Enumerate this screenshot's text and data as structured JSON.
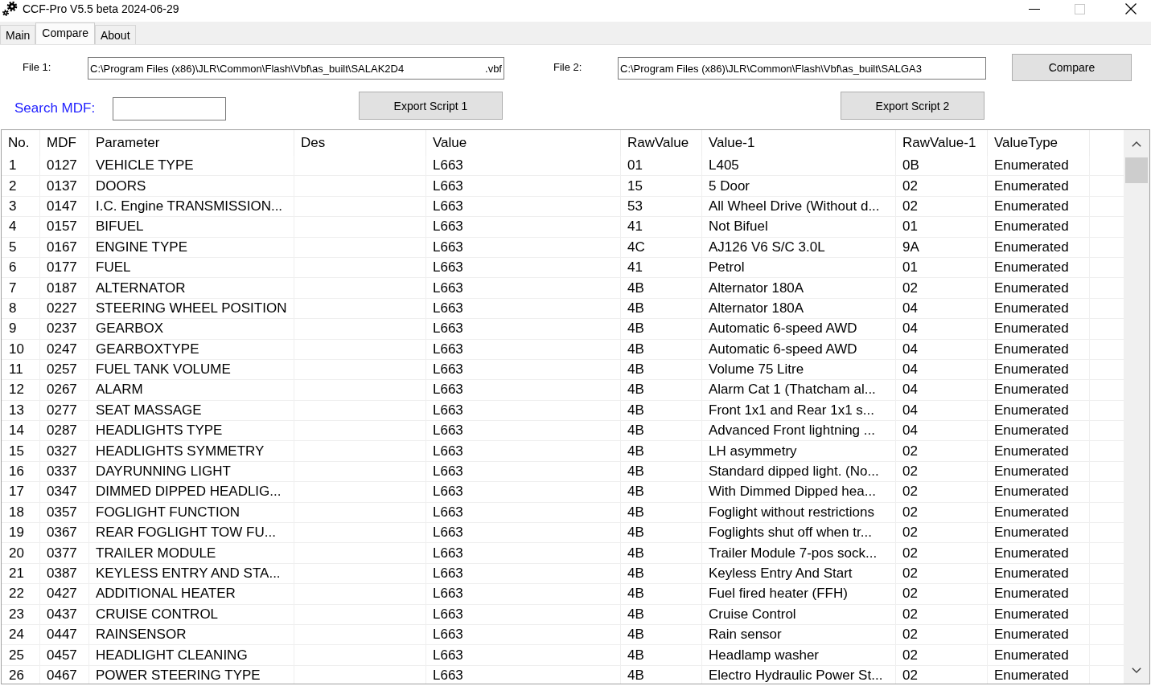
{
  "window": {
    "title": "CCF-Pro V5.5 beta 2024-06-29",
    "maximize_disabled": true
  },
  "tabs": [
    {
      "label": "Main",
      "selected": false
    },
    {
      "label": "Compare",
      "selected": true
    },
    {
      "label": "About",
      "selected": false
    }
  ],
  "file_1": {
    "label": "File 1:",
    "value": "C:\\Program Files (x86)\\JLR\\Common\\Flash\\Vbf\\as_built\\SALAK2D4",
    "value_end": ".vbf"
  },
  "file_2": {
    "label": "File 2:",
    "value": "C:\\Program Files (x86)\\JLR\\Common\\Flash\\Vbf\\as_built\\SALGA3"
  },
  "compare_button": "Compare",
  "search": {
    "label": "Search MDF:"
  },
  "export_buttons": [
    "Export Script 1",
    "Export Script 2"
  ],
  "table": {
    "columns": [
      "No.",
      "MDF",
      "Parameter",
      "Des",
      "Value",
      "RawValue",
      "Value-1",
      "RawValue-1",
      "ValueType"
    ],
    "rows": [
      {
        "no": "1",
        "mdf": "0127",
        "parameter": "VEHICLE TYPE",
        "value": "L663",
        "raw_value": "01",
        "value_1": "L405",
        "raw_value_1": "0B",
        "value_type": "Enumerated"
      },
      {
        "no": "2",
        "mdf": "0137",
        "parameter": "DOORS",
        "value": "L663",
        "raw_value": "15",
        "value_1": "5 Door",
        "raw_value_1": "02",
        "value_type": "Enumerated"
      },
      {
        "no": "3",
        "mdf": "0147",
        "parameter": "I.C. Engine TRANSMISSION...",
        "value": "L663",
        "raw_value": "53",
        "value_1": "All Wheel Drive (Without d...",
        "raw_value_1": "02",
        "value_type": "Enumerated"
      },
      {
        "no": "4",
        "mdf": "0157",
        "parameter": "BIFUEL",
        "value": "L663",
        "raw_value": "41",
        "value_1": "Not Bifuel",
        "raw_value_1": "01",
        "value_type": "Enumerated"
      },
      {
        "no": "5",
        "mdf": "0167",
        "parameter": "ENGINE TYPE",
        "value": "L663",
        "raw_value": "4C",
        "value_1": "AJ126 V6 S/C 3.0L",
        "raw_value_1": "9A",
        "value_type": "Enumerated"
      },
      {
        "no": "6",
        "mdf": "0177",
        "parameter": "FUEL",
        "value": "L663",
        "raw_value": "41",
        "value_1": "Petrol",
        "raw_value_1": "01",
        "value_type": "Enumerated"
      },
      {
        "no": "7",
        "mdf": "0187",
        "parameter": "ALTERNATOR",
        "value": "L663",
        "raw_value": "4B",
        "value_1": "Alternator 180A",
        "raw_value_1": "02",
        "value_type": "Enumerated"
      },
      {
        "no": "8",
        "mdf": "0227",
        "parameter": "STEERING WHEEL POSITION",
        "value": "L663",
        "raw_value": "4B",
        "value_1": "Alternator 180A",
        "raw_value_1": "04",
        "value_type": "Enumerated"
      },
      {
        "no": "9",
        "mdf": "0237",
        "parameter": "GEARBOX",
        "value": "L663",
        "raw_value": "4B",
        "value_1": "Automatic 6-speed AWD",
        "raw_value_1": "04",
        "value_type": "Enumerated"
      },
      {
        "no": "10",
        "mdf": "0247",
        "parameter": "GEARBOXTYPE",
        "value": "L663",
        "raw_value": "4B",
        "value_1": "Automatic 6-speed AWD",
        "raw_value_1": "04",
        "value_type": "Enumerated"
      },
      {
        "no": "11",
        "mdf": "0257",
        "parameter": "FUEL TANK VOLUME",
        "value": "L663",
        "raw_value": "4B",
        "value_1": "Volume 75 Litre",
        "raw_value_1": "04",
        "value_type": "Enumerated"
      },
      {
        "no": "12",
        "mdf": "0267",
        "parameter": "ALARM",
        "value": "L663",
        "raw_value": "4B",
        "value_1": "Alarm Cat 1 (Thatcham al...",
        "raw_value_1": "04",
        "value_type": "Enumerated"
      },
      {
        "no": "13",
        "mdf": "0277",
        "parameter": "SEAT MASSAGE",
        "value": "L663",
        "raw_value": "4B",
        "value_1": "Front 1x1 and Rear 1x1 s...",
        "raw_value_1": "04",
        "value_type": "Enumerated"
      },
      {
        "no": "14",
        "mdf": "0287",
        "parameter": "HEADLIGHTS TYPE",
        "value": "L663",
        "raw_value": "4B",
        "value_1": "Advanced Front lightning ...",
        "raw_value_1": "04",
        "value_type": "Enumerated"
      },
      {
        "no": "15",
        "mdf": "0327",
        "parameter": "HEADLIGHTS SYMMETRY",
        "value": "L663",
        "raw_value": "4B",
        "value_1": "LH asymmetry",
        "raw_value_1": "02",
        "value_type": "Enumerated"
      },
      {
        "no": "16",
        "mdf": "0337",
        "parameter": "DAYRUNNING LIGHT",
        "value": "L663",
        "raw_value": "4B",
        "value_1": "Standard dipped light. (No...",
        "raw_value_1": "02",
        "value_type": "Enumerated"
      },
      {
        "no": "17",
        "mdf": "0347",
        "parameter": "DIMMED DIPPED HEADLIG...",
        "value": "L663",
        "raw_value": "4B",
        "value_1": "With Dimmed Dipped hea...",
        "raw_value_1": "02",
        "value_type": "Enumerated"
      },
      {
        "no": "18",
        "mdf": "0357",
        "parameter": "FOGLIGHT FUNCTION",
        "value": "L663",
        "raw_value": "4B",
        "value_1": "Foglight without restrictions",
        "raw_value_1": "02",
        "value_type": "Enumerated"
      },
      {
        "no": "19",
        "mdf": "0367",
        "parameter": "REAR FOGLIGHT TOW FU...",
        "value": "L663",
        "raw_value": "4B",
        "value_1": "Foglights shut off when tr...",
        "raw_value_1": "02",
        "value_type": "Enumerated"
      },
      {
        "no": "20",
        "mdf": "0377",
        "parameter": "TRAILER MODULE",
        "value": "L663",
        "raw_value": "4B",
        "value_1": "Trailer Module 7-pos sock...",
        "raw_value_1": "02",
        "value_type": "Enumerated"
      },
      {
        "no": "21",
        "mdf": "0387",
        "parameter": "KEYLESS ENTRY AND STA...",
        "value": "L663",
        "raw_value": "4B",
        "value_1": "Keyless Entry And Start",
        "raw_value_1": "02",
        "value_type": "Enumerated"
      },
      {
        "no": "22",
        "mdf": "0427",
        "parameter": "ADDITIONAL HEATER",
        "value": "L663",
        "raw_value": "4B",
        "value_1": "Fuel fired heater (FFH)",
        "raw_value_1": "02",
        "value_type": "Enumerated"
      },
      {
        "no": "23",
        "mdf": "0437",
        "parameter": "CRUISE CONTROL",
        "value": "L663",
        "raw_value": "4B",
        "value_1": "Cruise Control",
        "raw_value_1": "02",
        "value_type": "Enumerated"
      },
      {
        "no": "24",
        "mdf": "0447",
        "parameter": "RAINSENSOR",
        "value": "L663",
        "raw_value": "4B",
        "value_1": "Rain sensor",
        "raw_value_1": "02",
        "value_type": "Enumerated"
      },
      {
        "no": "25",
        "mdf": "0457",
        "parameter": "HEADLIGHT CLEANING",
        "value": "L663",
        "raw_value": "4B",
        "value_1": "Headlamp washer",
        "raw_value_1": "02",
        "value_type": "Enumerated"
      },
      {
        "no": "26",
        "mdf": "0467",
        "parameter": "POWER STEERING TYPE",
        "value": "L663",
        "raw_value": "4B",
        "value_1": "Electro Hydraulic Power St...",
        "raw_value_1": "02",
        "value_type": "Enumerated"
      }
    ]
  }
}
